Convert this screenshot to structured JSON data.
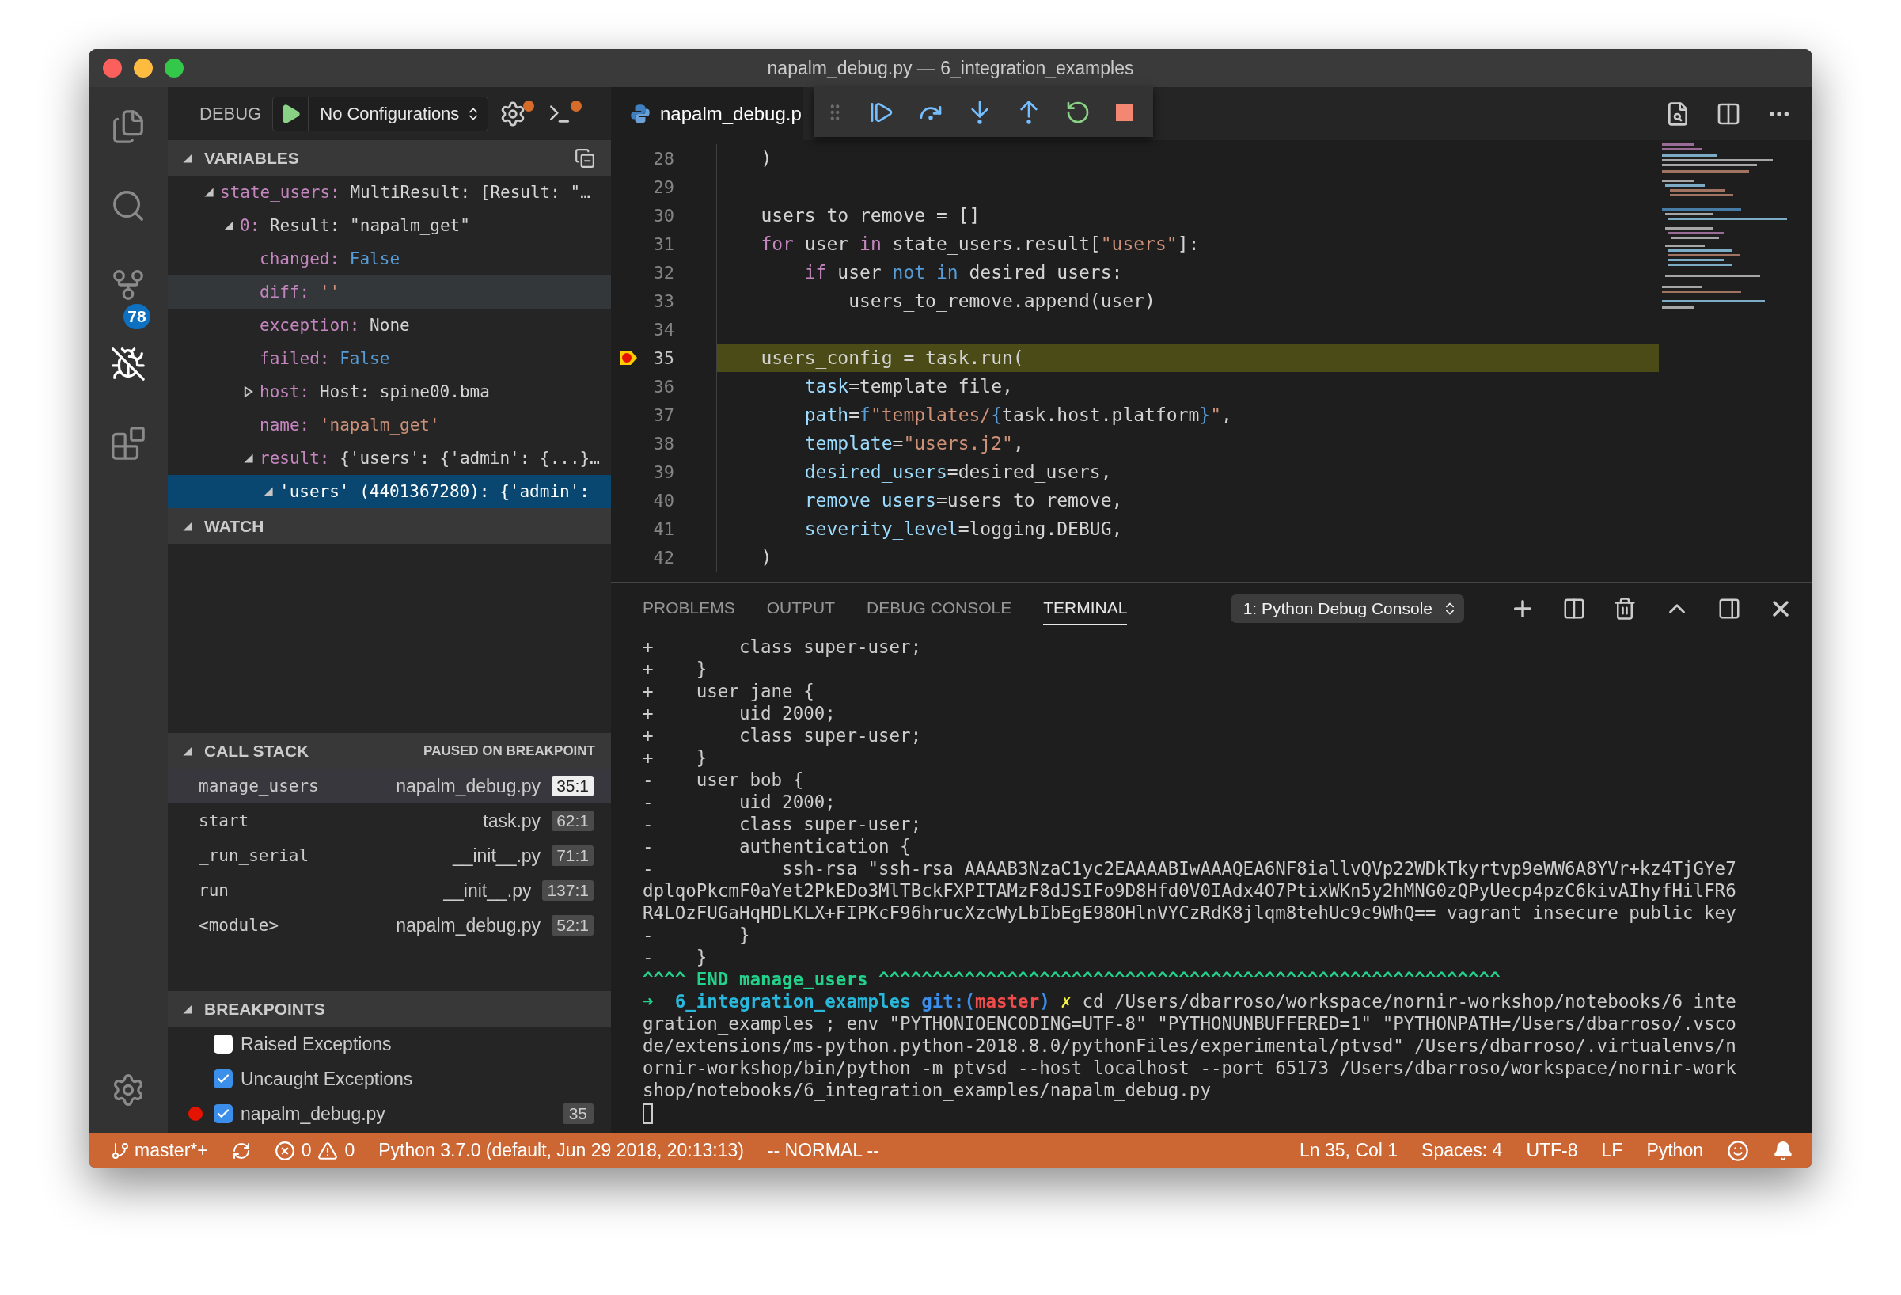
{
  "window": {
    "title": "napalm_debug.py — 6_integration_examples"
  },
  "activity_bar": {
    "items": [
      {
        "kind": "explorer",
        "selected": false
      },
      {
        "kind": "search",
        "selected": false
      },
      {
        "kind": "source_control",
        "selected": false,
        "badge": "78"
      },
      {
        "kind": "debug",
        "selected": true
      },
      {
        "kind": "extensions",
        "selected": false
      }
    ]
  },
  "debug_toolbar": {
    "label": "DEBUG",
    "configuration": "No Configurations"
  },
  "variables": {
    "title": "VARIABLES",
    "expanded": true,
    "items": [
      {
        "name": "state_users:",
        "value": "MultiResult: [Result: \"…",
        "kind": "plain",
        "expanded": true,
        "selected": false,
        "hovered": false,
        "children": [
          {
            "name": "0:",
            "value": "Result: \"napalm_get\"",
            "kind": "plain",
            "expanded": true,
            "selected": false,
            "hovered": false,
            "children": [
              {
                "name": "changed:",
                "value": "False",
                "kind": "keyword",
                "selected": false,
                "hovered": false
              },
              {
                "name": "diff:",
                "value": "''",
                "kind": "string",
                "selected": false,
                "hovered": true
              },
              {
                "name": "exception:",
                "value": "None",
                "kind": "plain",
                "selected": false,
                "hovered": false
              },
              {
                "name": "failed:",
                "value": "False",
                "kind": "keyword",
                "selected": false,
                "hovered": false
              },
              {
                "name": "host:",
                "value": "Host: spine00.bma",
                "kind": "plain",
                "expanded": false,
                "selected": false,
                "hovered": false
              },
              {
                "name": "name:",
                "value": "'napalm_get'",
                "kind": "string",
                "selected": false,
                "hovered": false
              },
              {
                "name": "result:",
                "value": "{'users': {'admin': {...}…",
                "kind": "plain",
                "expanded": true,
                "selected": false,
                "hovered": false,
                "children": [
                  {
                    "name": "'users' (4401367280):",
                    "value": "{'admin':",
                    "kind": "plain",
                    "expanded": true,
                    "selected": true,
                    "hovered": false
                  }
                ]
              }
            ]
          }
        ]
      }
    ]
  },
  "watch": {
    "title": "WATCH",
    "expanded": true
  },
  "call_stack": {
    "title": "CALL STACK",
    "status": "PAUSED ON BREAKPOINT",
    "expanded": true,
    "frames": [
      {
        "name": "manage_users",
        "file": "napalm_debug.py",
        "position": "35:1",
        "selected": true
      },
      {
        "name": "start",
        "file": "task.py",
        "position": "62:1",
        "selected": false
      },
      {
        "name": "_run_serial",
        "file": "__init__.py",
        "position": "71:1",
        "selected": false
      },
      {
        "name": "run",
        "file": "__init__.py",
        "position": "137:1",
        "selected": false
      },
      {
        "name": "<module>",
        "file": "napalm_debug.py",
        "position": "52:1",
        "selected": false
      }
    ]
  },
  "breakpoints": {
    "title": "BREAKPOINTS",
    "expanded": true,
    "items": [
      {
        "kind": "exception",
        "label": "Raised Exceptions",
        "checked": false
      },
      {
        "kind": "exception",
        "label": "Uncaught Exceptions",
        "checked": true
      },
      {
        "kind": "source",
        "label": "napalm_debug.py",
        "checked": true,
        "line": "35"
      }
    ]
  },
  "editor": {
    "tab": {
      "label": "napalm_debug.p"
    },
    "lines": [
      {
        "number": "28",
        "breakpoint": false,
        "current": false,
        "tokens": [
          {
            "text": "    )",
            "kind": "plain"
          }
        ]
      },
      {
        "number": "29",
        "breakpoint": false,
        "current": false
      },
      {
        "number": "30",
        "breakpoint": false,
        "current": false,
        "tokens": [
          {
            "text": "    users_to_remove = []",
            "kind": "plain"
          }
        ]
      },
      {
        "number": "31",
        "breakpoint": false,
        "current": false,
        "tokens": [
          {
            "text": "    for",
            "kind": "keyword"
          },
          {
            "text": " user ",
            "kind": "plain"
          },
          {
            "text": "in",
            "kind": "keyword"
          },
          {
            "text": " state_users.result[",
            "kind": "plain"
          },
          {
            "text": "\"users\"",
            "kind": "string"
          },
          {
            "text": "]:",
            "kind": "plain"
          }
        ]
      },
      {
        "number": "32",
        "breakpoint": false,
        "current": false,
        "tokens": [
          {
            "text": "        if",
            "kind": "keyword"
          },
          {
            "text": " user ",
            "kind": "plain"
          },
          {
            "text": "not in",
            "kind": "builtin"
          },
          {
            "text": " desired_users:",
            "kind": "plain"
          }
        ]
      },
      {
        "number": "33",
        "breakpoint": false,
        "current": false,
        "tokens": [
          {
            "text": "            users_to_remove.append(user)",
            "kind": "plain"
          }
        ]
      },
      {
        "number": "34",
        "breakpoint": false,
        "current": false
      },
      {
        "number": "35",
        "breakpoint": true,
        "current": true,
        "tokens": [
          {
            "text": "    users_config = task.run(",
            "kind": "plain"
          }
        ]
      },
      {
        "number": "36",
        "breakpoint": false,
        "current": false,
        "tokens": [
          {
            "text": "        task",
            "kind": "param"
          },
          {
            "text": "=template_file,",
            "kind": "plain"
          }
        ]
      },
      {
        "number": "37",
        "breakpoint": false,
        "current": false,
        "tokens": [
          {
            "text": "        path",
            "kind": "param"
          },
          {
            "text": "=",
            "kind": "plain"
          },
          {
            "text": "f",
            "kind": "builtin"
          },
          {
            "text": "\"templates/",
            "kind": "string"
          },
          {
            "text": "{",
            "kind": "builtin"
          },
          {
            "text": "task.host.platform",
            "kind": "plain"
          },
          {
            "text": "}",
            "kind": "builtin"
          },
          {
            "text": "\"",
            "kind": "string"
          },
          {
            "text": ",",
            "kind": "plain"
          }
        ]
      },
      {
        "number": "38",
        "breakpoint": false,
        "current": false,
        "tokens": [
          {
            "text": "        template",
            "kind": "param"
          },
          {
            "text": "=",
            "kind": "plain"
          },
          {
            "text": "\"users.j2\"",
            "kind": "string"
          },
          {
            "text": ",",
            "kind": "plain"
          }
        ]
      },
      {
        "number": "39",
        "breakpoint": false,
        "current": false,
        "tokens": [
          {
            "text": "        desired_users",
            "kind": "param"
          },
          {
            "text": "=desired_users,",
            "kind": "plain"
          }
        ]
      },
      {
        "number": "40",
        "breakpoint": false,
        "current": false,
        "tokens": [
          {
            "text": "        remove_users",
            "kind": "param"
          },
          {
            "text": "=users_to_remove,",
            "kind": "plain"
          }
        ]
      },
      {
        "number": "41",
        "breakpoint": false,
        "current": false,
        "tokens": [
          {
            "text": "        severity_level",
            "kind": "param"
          },
          {
            "text": "=logging.DEBUG,",
            "kind": "plain"
          }
        ]
      },
      {
        "number": "42",
        "breakpoint": false,
        "current": false,
        "tokens": [
          {
            "text": "    )",
            "kind": "plain"
          }
        ]
      }
    ]
  },
  "panel": {
    "tabs": [
      {
        "label": "PROBLEMS",
        "selected": false
      },
      {
        "label": "OUTPUT",
        "selected": false
      },
      {
        "label": "DEBUG CONSOLE",
        "selected": false
      },
      {
        "label": "TERMINAL",
        "selected": true
      }
    ],
    "terminal_selector": "1: Python Debug Console",
    "terminal": {
      "cursor_visible": true,
      "lines": [
        {
          "segments": [
            {
              "text": "+        class super-user;",
              "kind": "plain"
            }
          ]
        },
        {
          "segments": [
            {
              "text": "+    }",
              "kind": "plain"
            }
          ]
        },
        {
          "segments": [
            {
              "text": "+    user jane {",
              "kind": "plain"
            }
          ]
        },
        {
          "segments": [
            {
              "text": "+        uid 2000;",
              "kind": "plain"
            }
          ]
        },
        {
          "segments": [
            {
              "text": "+        class super-user;",
              "kind": "plain"
            }
          ]
        },
        {
          "segments": [
            {
              "text": "+    }",
              "kind": "plain"
            }
          ]
        },
        {
          "segments": [
            {
              "text": "-    user bob {",
              "kind": "plain"
            }
          ]
        },
        {
          "segments": [
            {
              "text": "-        uid 2000;",
              "kind": "plain"
            }
          ]
        },
        {
          "segments": [
            {
              "text": "-        class super-user;",
              "kind": "plain"
            }
          ]
        },
        {
          "segments": [
            {
              "text": "-        authentication {",
              "kind": "plain"
            }
          ]
        },
        {
          "segments": [
            {
              "text": "-            ssh-rsa \"ssh-rsa AAAAB3NzaC1yc2EAAAABIwAAAQEA6NF8iallvQVp22WDkTkyrtvp9eWW6A8YVr+kz4TjGYe7",
              "kind": "plain"
            }
          ]
        },
        {
          "segments": [
            {
              "text": "dplqoPkcmF0aYet2PkEDo3MlTBckFXPITAMzF8dJSIFo9D8Hfd0V0IAdx4O7PtixWKn5y2hMNG0zQPyUecp4pzC6kivAIhyfHilFR6",
              "kind": "plain"
            }
          ]
        },
        {
          "segments": [
            {
              "text": "R4LOzFUGaHqHDLKLX+FIPKcF96hrucXzcWyLbIbEgE98OHlnVYCzRdK8jlqm8tehUc9c9WhQ== vagrant insecure public key",
              "kind": "plain"
            }
          ]
        },
        {
          "segments": [
            {
              "text": "-        }",
              "kind": "plain"
            }
          ]
        },
        {
          "segments": [
            {
              "text": "-    }",
              "kind": "plain"
            }
          ]
        },
        {
          "segments": [
            {
              "text": "^^^^ END manage_users ^^^^^^^^^^^^^^^^^^^^^^^^^^^^^^^^^^^^^^^^^^^^^^^^^^^^^^^^^^",
              "kind": "success"
            }
          ]
        },
        {
          "segments": [
            {
              "text": "➜  ",
              "kind": "arrow"
            },
            {
              "text": "6_integration_examples",
              "kind": "dir"
            },
            {
              "text": " git:(",
              "kind": "git"
            },
            {
              "text": "master",
              "kind": "branch"
            },
            {
              "text": ")",
              "kind": "git"
            },
            {
              "text": " ✗",
              "kind": "dirty"
            },
            {
              "text": " cd /Users/dbarroso/workspace/nornir-workshop/notebooks/6_inte",
              "kind": "plain"
            }
          ]
        },
        {
          "segments": [
            {
              "text": "gration_examples ; env \"PYTHONIOENCODING=UTF-8\" \"PYTHONUNBUFFERED=1\" \"PYTHONPATH=/Users/dbarroso/.vsco",
              "kind": "plain"
            }
          ]
        },
        {
          "segments": [
            {
              "text": "de/extensions/ms-python.python-2018.8.0/pythonFiles/experimental/ptvsd\" /Users/dbarroso/.virtualenvs/n",
              "kind": "plain"
            }
          ]
        },
        {
          "segments": [
            {
              "text": "ornir-workshop/bin/python -m ptvsd --host localhost --port 65173 /Users/dbarroso/workspace/nornir-work",
              "kind": "plain"
            }
          ]
        },
        {
          "segments": [
            {
              "text": "shop/notebooks/6_integration_examples/napalm_debug.py",
              "kind": "plain"
            }
          ]
        }
      ]
    }
  },
  "status_bar": {
    "branch": "master*+",
    "errors": "0",
    "warnings": "0",
    "interpreter": "Python 3.7.0 (default, Jun 29 2018, 20:13:13)",
    "mode": "-- NORMAL --",
    "position": "Ln 35, Col 1",
    "indentation": "Spaces: 4",
    "encoding": "UTF-8",
    "line_ending": "LF",
    "language": "Python"
  }
}
